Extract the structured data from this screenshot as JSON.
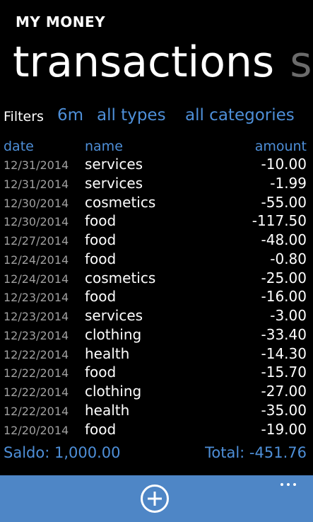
{
  "app": {
    "title": "MY MONEY"
  },
  "pivot": {
    "active": "transactions",
    "next": "sh"
  },
  "filters": {
    "label": "Filters",
    "period": "6m",
    "types": "all types",
    "categories": "all categories"
  },
  "columns": {
    "date": "date",
    "name": "name",
    "amount": "amount"
  },
  "transactions": [
    {
      "date": "12/31/2014",
      "name": "services",
      "amount": "-10.00"
    },
    {
      "date": "12/31/2014",
      "name": "services",
      "amount": "-1.99"
    },
    {
      "date": "12/30/2014",
      "name": "cosmetics",
      "amount": "-55.00"
    },
    {
      "date": "12/30/2014",
      "name": "food",
      "amount": "-117.50"
    },
    {
      "date": "12/27/2014",
      "name": "food",
      "amount": "-48.00"
    },
    {
      "date": "12/24/2014",
      "name": "food",
      "amount": "-0.80"
    },
    {
      "date": "12/24/2014",
      "name": "cosmetics",
      "amount": "-25.00"
    },
    {
      "date": "12/23/2014",
      "name": "food",
      "amount": "-16.00"
    },
    {
      "date": "12/23/2014",
      "name": "services",
      "amount": "-3.00"
    },
    {
      "date": "12/23/2014",
      "name": "clothing",
      "amount": "-33.40"
    },
    {
      "date": "12/22/2014",
      "name": "health",
      "amount": "-14.30"
    },
    {
      "date": "12/22/2014",
      "name": "food",
      "amount": "-15.70"
    },
    {
      "date": "12/22/2014",
      "name": "clothing",
      "amount": "-27.00"
    },
    {
      "date": "12/22/2014",
      "name": "health",
      "amount": "-35.00"
    },
    {
      "date": "12/20/2014",
      "name": "food",
      "amount": "-19.00"
    }
  ],
  "summary": {
    "saldo": "Saldo: 1,000.00",
    "total": "Total: -451.76"
  },
  "appbar": {
    "add_icon": "add-circle-icon",
    "more_icon": "more-ellipsis-icon"
  },
  "colors": {
    "accent": "#4e8fd8",
    "appbar": "#4e86c6",
    "background": "#000000",
    "muted_text": "#a0a0a0",
    "inactive_pivot": "#6b6b6b"
  }
}
